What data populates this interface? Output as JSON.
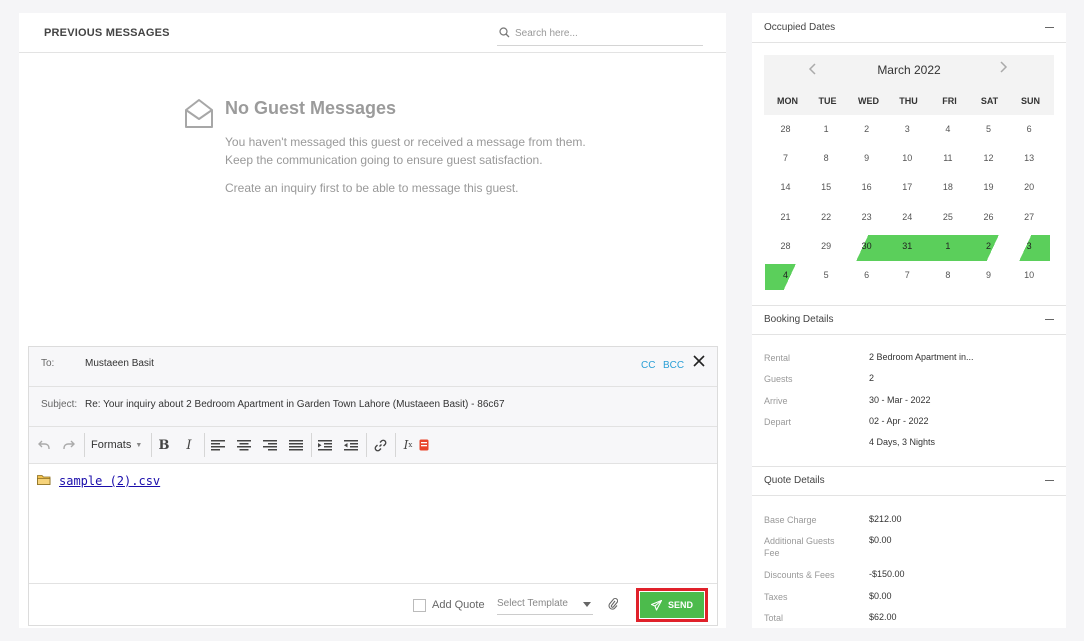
{
  "messages": {
    "title": "PREVIOUS MESSAGES",
    "search_placeholder": "Search here...",
    "empty_title": "No Guest Messages",
    "empty_line1": "You haven't messaged this guest or received a message from them.",
    "empty_line2": "Keep the communication going to ensure guest satisfaction.",
    "empty_line3": "Create an inquiry first to be able to message this guest."
  },
  "compose": {
    "to_label": "To:",
    "to_value": "Mustaeen Basit",
    "cc_label": "CC",
    "bcc_label": "BCC",
    "subject_label": "Subject:",
    "subject_value": "Re: Your inquiry about 2 Bedroom Apartment in Garden Town Lahore (Mustaeen Basit) - 86c67",
    "formats_label": "Formats",
    "attachment_name": "sample (2).csv",
    "add_quote_label": "Add Quote",
    "template_placeholder": "Select Template",
    "send_label": "SEND"
  },
  "toolbar_icons": [
    "undo-icon",
    "redo-icon",
    "bold-icon",
    "italic-icon",
    "align-left-icon",
    "align-center-icon",
    "align-right-icon",
    "align-justify-icon",
    "indent-icon",
    "outdent-icon",
    "link-icon",
    "clear-format-icon",
    "insert-snippet-icon"
  ],
  "colors": {
    "accent_green": "#4cbb4c",
    "booking_green": "#5bcf5b",
    "highlight_red": "#e0212a",
    "link_blue": "#2a9fd6"
  },
  "occupied_dates": {
    "title": "Occupied Dates",
    "month": "March 2022",
    "weekdays": [
      "MON",
      "TUE",
      "WED",
      "THU",
      "FRI",
      "SAT",
      "SUN"
    ],
    "weeks": [
      [
        "28",
        "1",
        "2",
        "3",
        "4",
        "5",
        "6"
      ],
      [
        "7",
        "8",
        "9",
        "10",
        "11",
        "12",
        "13"
      ],
      [
        "14",
        "15",
        "16",
        "17",
        "18",
        "19",
        "20"
      ],
      [
        "21",
        "22",
        "23",
        "24",
        "25",
        "26",
        "27"
      ],
      [
        "28",
        "29",
        "30",
        "31",
        "1",
        "2",
        "3"
      ],
      [
        "4",
        "5",
        "6",
        "7",
        "8",
        "9",
        "10"
      ]
    ],
    "booked_ranges": [
      "30 Mar - 2 Apr 2022",
      "3 Apr - 4 Apr 2022"
    ]
  },
  "booking_details": {
    "title": "Booking Details",
    "rental_label": "Rental",
    "rental_value": "2 Bedroom Apartment in...",
    "guests_label": "Guests",
    "guests_value": "2",
    "arrive_label": "Arrive",
    "arrive_value": "30 - Mar - 2022",
    "depart_label": "Depart",
    "depart_value": "02 - Apr - 2022",
    "stay_length": "4 Days, 3 Nights"
  },
  "quote_details": {
    "title": "Quote Details",
    "base_label": "Base Charge",
    "base_value": "$212.00",
    "additional_label_1": "Additional Guests",
    "additional_label_2": "Fee",
    "additional_value": "$0.00",
    "discounts_label": "Discounts & Fees",
    "discounts_value": "-$150.00",
    "taxes_label": "Taxes",
    "taxes_value": "$0.00",
    "total_label": "Total",
    "total_value": "$62.00"
  }
}
